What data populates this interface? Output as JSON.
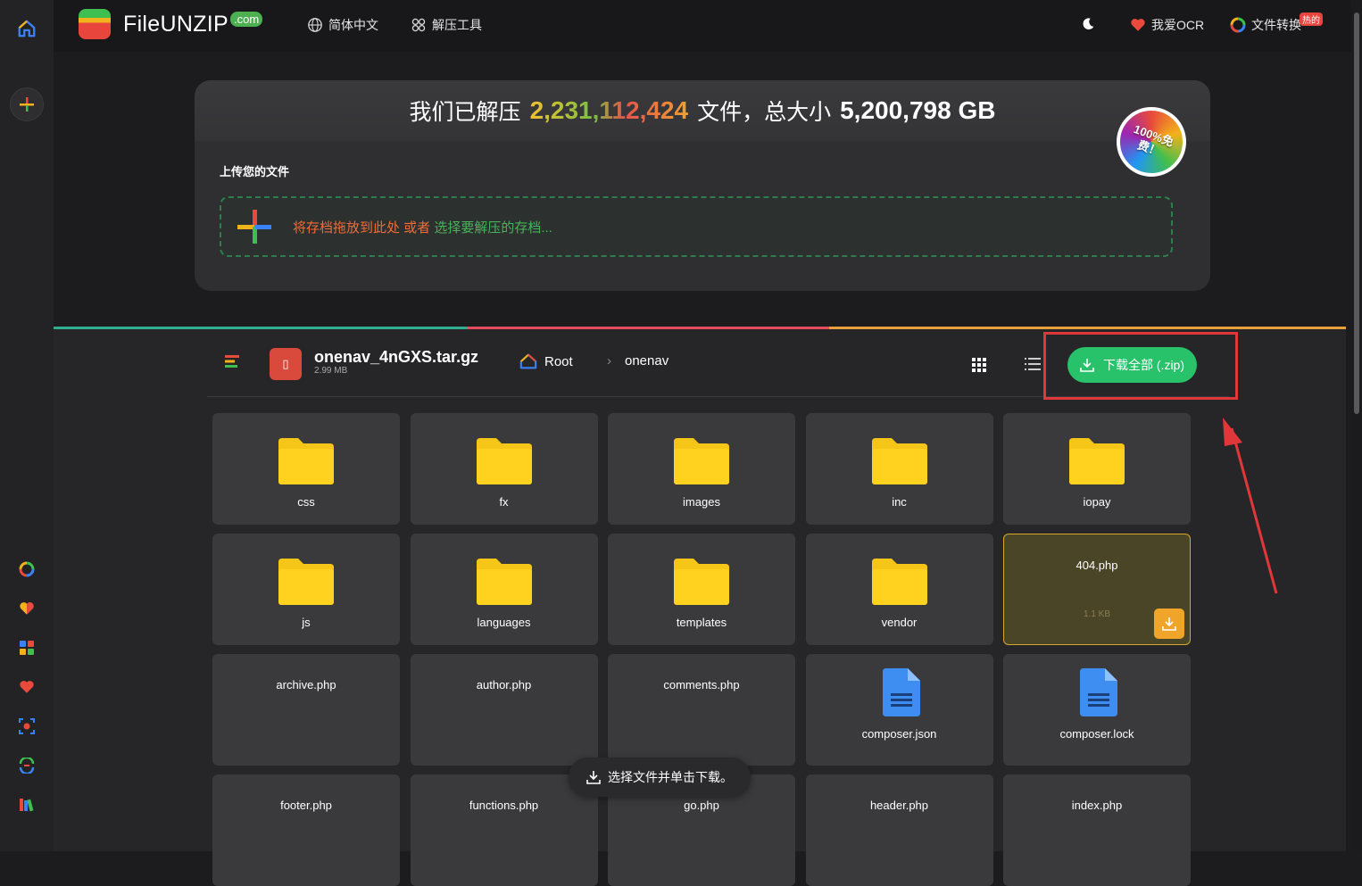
{
  "header": {
    "logo_text": "FileUNZIP",
    "logo_suffix": ".com",
    "nav": [
      {
        "label": "简体中文",
        "icon": "globe-icon"
      },
      {
        "label": "解压工具",
        "icon": "apps-icon"
      }
    ],
    "right_links": [
      {
        "label": "我爱OCR",
        "icon": "heart-icon"
      },
      {
        "label": "文件转换",
        "icon": "convert-icon",
        "badge": "热的"
      }
    ]
  },
  "stats": {
    "prefix": "我们已解压",
    "file_count": "2,231,112,424",
    "middle": "文件，总大小",
    "total_size": "5,200,798 GB",
    "free_badge": "100%免费！"
  },
  "upload": {
    "label": "上传您的文件",
    "drop_text": "将存档拖放到此处 或者",
    "select_text": "选择要解压的存档..."
  },
  "archive": {
    "name": "onenav_4nGXS.tar.gz",
    "size": "2.99 MB",
    "breadcrumb_root": "Root",
    "breadcrumb_current": "onenav",
    "download_all_label": "下载全部 (.zip)"
  },
  "files": [
    {
      "name": "css",
      "type": "folder"
    },
    {
      "name": "fx",
      "type": "folder"
    },
    {
      "name": "images",
      "type": "folder"
    },
    {
      "name": "inc",
      "type": "folder"
    },
    {
      "name": "iopay",
      "type": "folder"
    },
    {
      "name": "js",
      "type": "folder"
    },
    {
      "name": "languages",
      "type": "folder"
    },
    {
      "name": "templates",
      "type": "folder"
    },
    {
      "name": "vendor",
      "type": "folder"
    },
    {
      "name": "404.php",
      "type": "php",
      "size": "1.1 KB",
      "selected": true
    },
    {
      "name": "archive.php",
      "type": "php"
    },
    {
      "name": "author.php",
      "type": "php"
    },
    {
      "name": "comments.php",
      "type": "php"
    },
    {
      "name": "composer.json",
      "type": "doc"
    },
    {
      "name": "composer.lock",
      "type": "doc"
    },
    {
      "name": "footer.php",
      "type": "php"
    },
    {
      "name": "functions.php",
      "type": "php"
    },
    {
      "name": "go.php",
      "type": "php"
    },
    {
      "name": "header.php",
      "type": "php"
    },
    {
      "name": "index.php",
      "type": "php"
    }
  ],
  "toast": "选择文件并单击下载。",
  "colors": {
    "accent_green": "#27c26a",
    "highlight_red": "#e0373a",
    "folder_yellow": "#f5c518",
    "doc_blue": "#3d8ef0"
  }
}
